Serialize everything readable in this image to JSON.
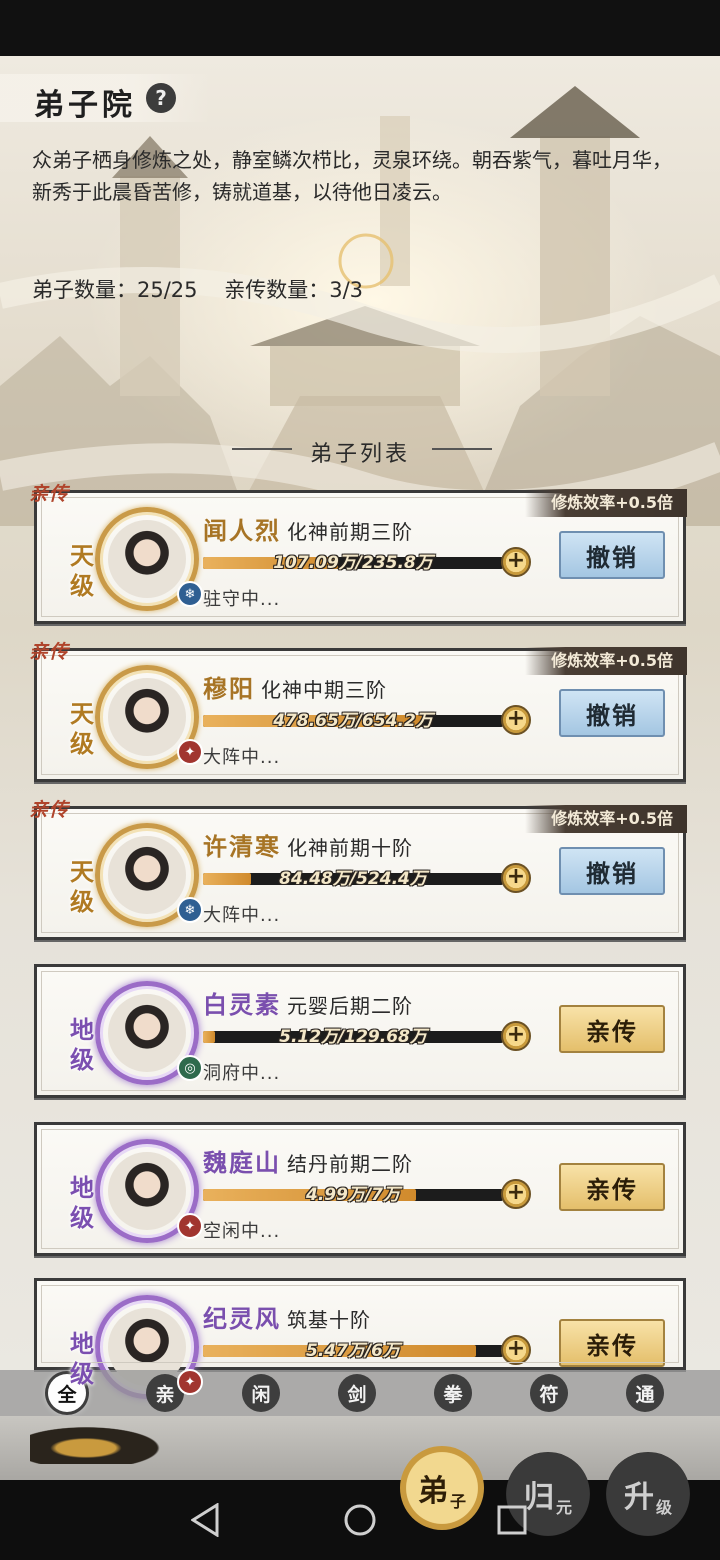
{
  "header": {
    "title": "弟子院",
    "help_icon": "question-icon",
    "description": "众弟子栖身修炼之处，静室鳞次栉比，灵泉环绕。朝吞紫气，暮吐月华，新秀于此晨昏苦修，铸就道基，以待他日凌云。",
    "disciple_count": "弟子数量：25/25",
    "personal_count": "亲传数量：3/3"
  },
  "list_title": "弟子列表",
  "disciples": [
    {
      "ribbon": "亲传",
      "efficiency": "修炼效率+0.5倍",
      "grade": "天级",
      "name": "闻人烈",
      "realm": "化神前期三阶",
      "progress_text": "107.09万/235.8万",
      "progress": 0.45,
      "status": "驻守中...",
      "action": "撤销",
      "element": "ice"
    },
    {
      "ribbon": "亲传",
      "efficiency": "修炼效率+0.5倍",
      "grade": "天级",
      "name": "穆阳",
      "realm": "化神中期三阶",
      "progress_text": "478.65万/654.2万",
      "progress": 0.73,
      "status": "大阵中...",
      "action": "撤销",
      "element": "fire"
    },
    {
      "ribbon": "亲传",
      "efficiency": "修炼效率+0.5倍",
      "grade": "天级",
      "name": "许清寒",
      "realm": "化神前期十阶",
      "progress_text": "84.48万/524.4万",
      "progress": 0.16,
      "status": "大阵中...",
      "action": "撤销",
      "element": "ice"
    },
    {
      "ribbon": "",
      "efficiency": "",
      "grade": "地级",
      "name": "白灵素",
      "realm": "元婴后期二阶",
      "progress_text": "5.12万/129.68万",
      "progress": 0.04,
      "status": "洞府中...",
      "action": "亲传",
      "element": "wind"
    },
    {
      "ribbon": "",
      "efficiency": "",
      "grade": "地级",
      "name": "魏庭山",
      "realm": "结丹前期二阶",
      "progress_text": "4.99万/7万",
      "progress": 0.71,
      "status": "空闲中...",
      "action": "亲传",
      "element": "fire"
    },
    {
      "ribbon": "",
      "efficiency": "",
      "grade": "地级",
      "name": "纪灵风",
      "realm": "筑基十阶",
      "progress_text": "5.47万/6万",
      "progress": 0.91,
      "status": "",
      "action": "亲传",
      "element": "fire"
    }
  ],
  "filters": [
    "全",
    "亲",
    "闲",
    "剑",
    "拳",
    "符",
    "通"
  ],
  "active_filter": 0,
  "bottom_tabs": [
    {
      "main": "弟",
      "sub": "子"
    },
    {
      "main": "归",
      "sub": "元"
    },
    {
      "main": "升",
      "sub": "级"
    }
  ],
  "system_nav": [
    "back-icon",
    "home-icon",
    "recents-icon"
  ],
  "colors": {
    "gold_name": "#a77425",
    "purple_name": "#7a4fae",
    "ribbon": "#b0442b"
  }
}
